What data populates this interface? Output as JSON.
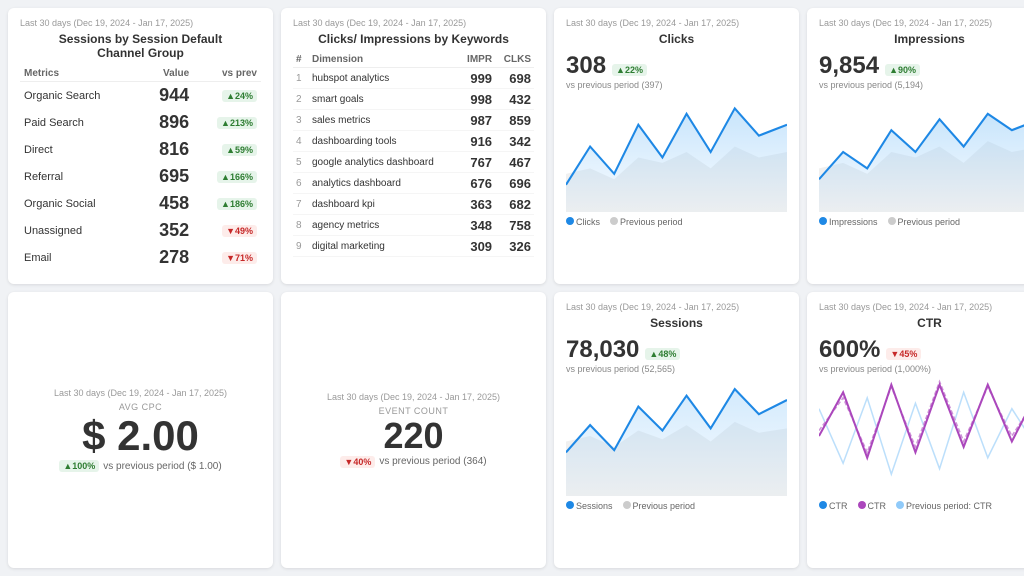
{
  "date_range": "Last 30 days (Dec 19, 2024 - Jan 17, 2025)",
  "sessions_card": {
    "title": "Sessions by Session Default\nChannel Group",
    "columns": [
      "Metrics",
      "Value",
      "vs prev"
    ],
    "rows": [
      {
        "metric": "Organic Search",
        "value": "944",
        "change": "24%",
        "direction": "up"
      },
      {
        "metric": "Paid Search",
        "value": "896",
        "change": "213%",
        "direction": "up"
      },
      {
        "metric": "Direct",
        "value": "816",
        "change": "59%",
        "direction": "up"
      },
      {
        "metric": "Referral",
        "value": "695",
        "change": "166%",
        "direction": "up"
      },
      {
        "metric": "Organic Social",
        "value": "458",
        "change": "186%",
        "direction": "up"
      },
      {
        "metric": "Unassigned",
        "value": "352",
        "change": "49%",
        "direction": "down"
      },
      {
        "metric": "Email",
        "value": "278",
        "change": "71%",
        "direction": "down"
      }
    ]
  },
  "keywords_card": {
    "title": "Clicks/ Impressions by Keywords",
    "columns": [
      "#",
      "Dimension",
      "IMPR",
      "CLKS"
    ],
    "rows": [
      {
        "num": "1",
        "dim": "hubspot analytics",
        "impr": "999",
        "clks": "698"
      },
      {
        "num": "2",
        "dim": "smart goals",
        "impr": "998",
        "clks": "432"
      },
      {
        "num": "3",
        "dim": "sales metrics",
        "impr": "987",
        "clks": "859"
      },
      {
        "num": "4",
        "dim": "dashboarding tools",
        "impr": "916",
        "clks": "342"
      },
      {
        "num": "5",
        "dim": "google analytics\ndashboard",
        "impr": "767",
        "clks": "467"
      },
      {
        "num": "6",
        "dim": "analytics dashboard",
        "impr": "676",
        "clks": "696"
      },
      {
        "num": "7",
        "dim": "dashboard kpi",
        "impr": "363",
        "clks": "682"
      },
      {
        "num": "8",
        "dim": "agency metrics",
        "impr": "348",
        "clks": "758"
      },
      {
        "num": "9",
        "dim": "digital marketing",
        "impr": "309",
        "clks": "326"
      }
    ]
  },
  "clicks_card": {
    "value": "308",
    "change": "22%",
    "direction": "up",
    "vs_text": "vs previous period (397)",
    "legend": [
      "Clicks",
      "Previous period"
    ]
  },
  "impressions_card": {
    "value": "9,854",
    "change": "90%",
    "direction": "up",
    "vs_text": "vs previous period (5,194)",
    "legend": [
      "Impressions",
      "Previous period"
    ]
  },
  "cpc_card": {
    "label": "AVG CPC",
    "value": "$ 2.00",
    "change": "100%",
    "direction": "up",
    "vs_text": "vs previous period ($ 1.00)"
  },
  "event_card": {
    "label": "Event Count",
    "value": "220",
    "change": "40%",
    "direction": "down",
    "vs_text": "vs previous period (364)"
  },
  "sessions_chart_card": {
    "value": "78,030",
    "change": "48%",
    "direction": "up",
    "vs_text": "vs previous period (52,565)",
    "legend": [
      "Sessions",
      "Previous period"
    ]
  },
  "ctr_card": {
    "value": "600%",
    "change": "45%",
    "direction": "down",
    "vs_text": "vs previous period (1,000%)",
    "legend": [
      "CTR",
      "CTR",
      "Previous period: CTR"
    ]
  }
}
